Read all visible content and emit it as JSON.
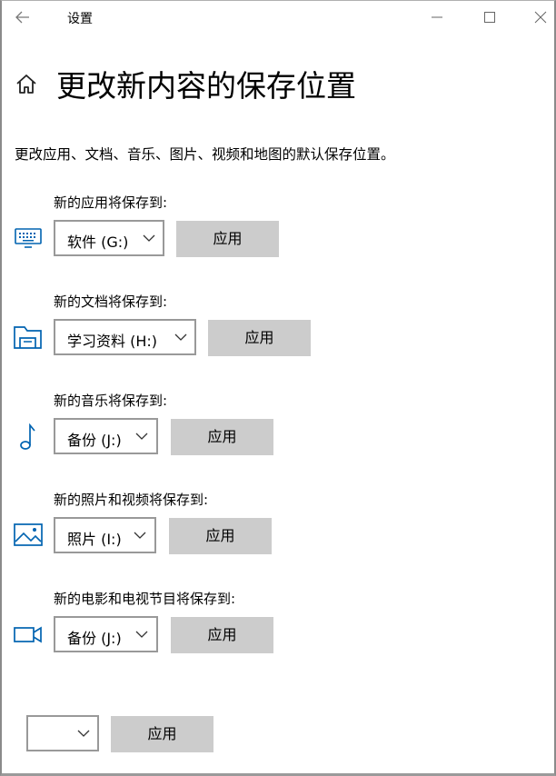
{
  "window": {
    "title": "设置"
  },
  "page": {
    "title": "更改新内容的保存位置",
    "description": "更改应用、文档、音乐、图片、视频和地图的默认保存位置。"
  },
  "sections": [
    {
      "icon": "keyboard-icon",
      "label": "新的应用将保存到:",
      "selected": "软件 (G:)",
      "apply": "应用"
    },
    {
      "icon": "folder-icon",
      "label": "新的文档将保存到:",
      "selected": "学习资料 (H:)",
      "apply": "应用"
    },
    {
      "icon": "music-note-icon",
      "label": "新的音乐将保存到:",
      "selected": "备份 (J:)",
      "apply": "应用"
    },
    {
      "icon": "image-icon",
      "label": "新的照片和视频将保存到:",
      "selected": "照片 (I:)",
      "apply": "应用"
    },
    {
      "icon": "video-camera-icon",
      "label": "新的电影和电视节目将保存到:",
      "selected": "备份 (J:)",
      "apply": "应用"
    },
    {
      "icon": "",
      "label": "",
      "selected": "",
      "apply": "应用"
    }
  ],
  "colors": {
    "accent": "#0063b1",
    "button_bg": "#cccccc",
    "dropdown_border": "#999999"
  }
}
